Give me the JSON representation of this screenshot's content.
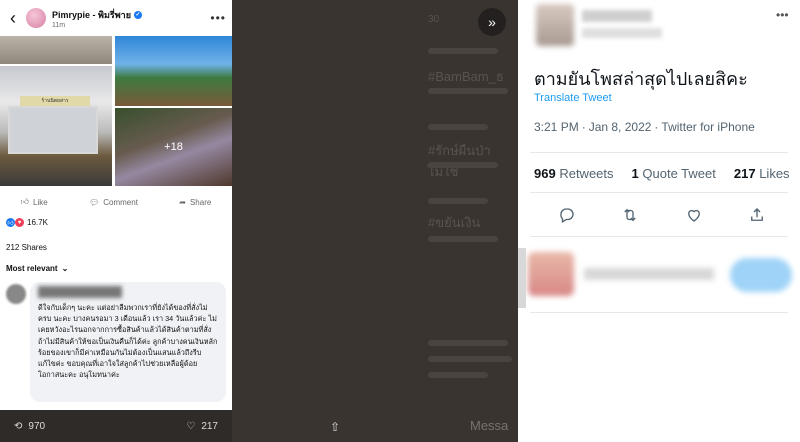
{
  "facebook": {
    "page_name": "Pimrypie - พิมรี่พาย",
    "time": "11m",
    "photo_overlay": "+18",
    "truck_sign": "ร้านนิตยสาร",
    "actions": {
      "like": "Like",
      "comment": "Comment",
      "share": "Share"
    },
    "reactions_count": "16.7K",
    "shares": "212 Shares",
    "sort_label": "Most relevant",
    "comment_text": "ดีใจกับเด็กๆ นะคะ แต่อย่าลืมพวกเราที่ยังได้ของที่สั่งไม่ครบ นะคะ บางคนรอมา 3 เดือนแล้ว เรา 34 วันแล้วค่ะ ไม่เคยหวังอะไรนอกจากการซื้อสินค้าแล้วได้สินค้าตามที่สั่ง ถ้าไม่มีสินค้าให้ขอเป็นเงินคืนก็ได้ค่ะ ลูกค้าบางคนเงินหลักร้อยของเขาก็มีค่าเหมือนกันไม่ต้องเป็นแสนแล้วถึงรีบแก้ไขค่ะ ขอบคุณที่เอาใจใส่ลูกค้าไปช่วยเหลือผู้ด้อยโอกาสนะคะ อนุโมทนาค่ะ"
  },
  "bottom_bar": {
    "retweets": "970",
    "likes": "217"
  },
  "middle": {
    "ghost_items": [
      "#BamBam_ธ",
      "#รักษ์ผืนป่าไม่ใช่",
      "#ขยันเงิน"
    ],
    "messages_label": "Messa"
  },
  "tweet": {
    "text": "ตามยันโพสล่าสุดไปเลยสิคะ",
    "translate_label": "Translate Tweet",
    "time": "3:21 PM",
    "date": "Jan 8, 2022",
    "client": "Twitter for iPhone",
    "retweets_count": "969",
    "retweets_label": "Retweets",
    "quote_count": "1",
    "quote_label": "Quote Tweet",
    "likes_count": "217",
    "likes_label": "Likes"
  }
}
